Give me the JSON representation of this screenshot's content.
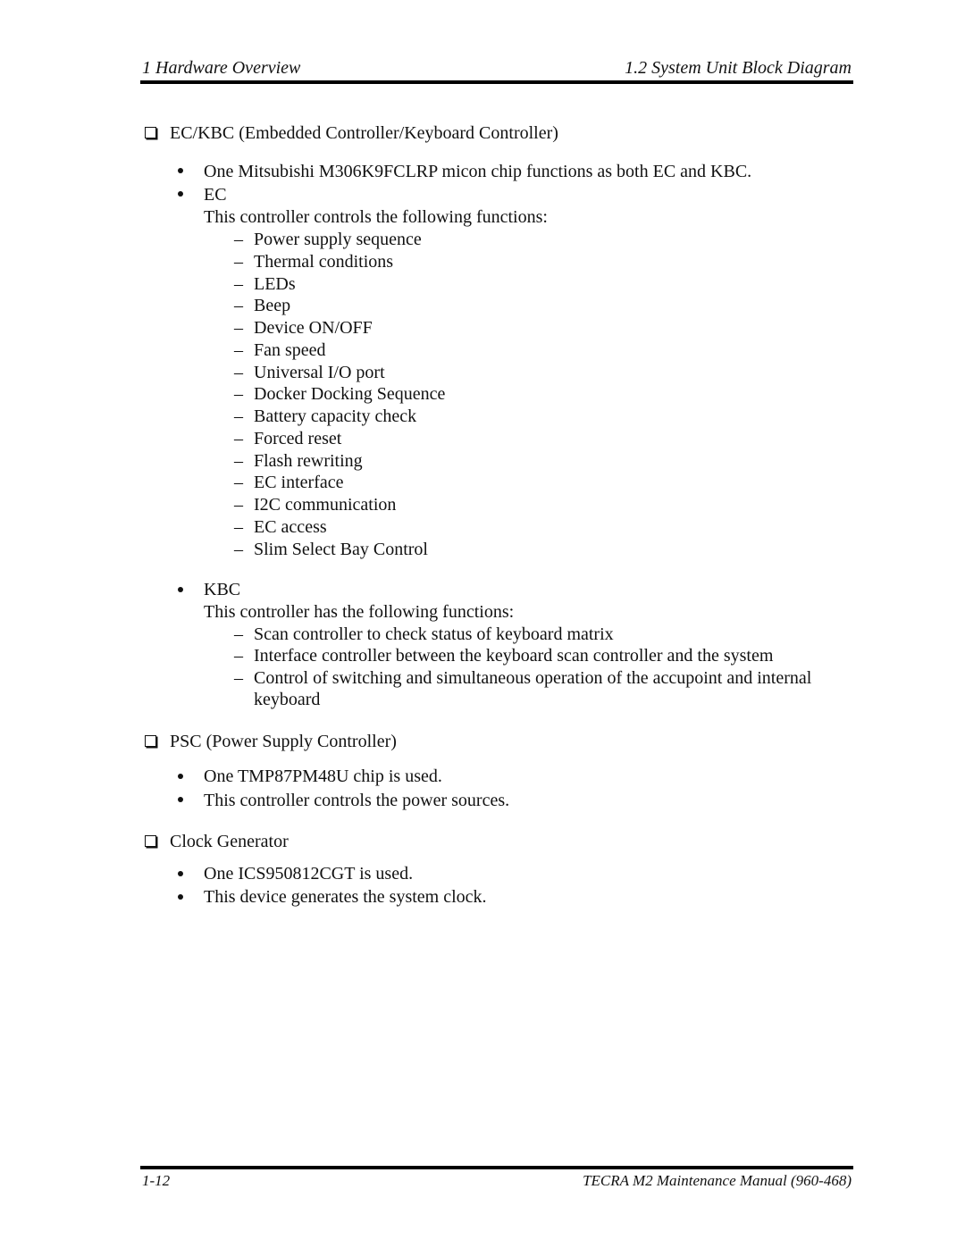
{
  "header": {
    "chapter": "1  Hardware Overview",
    "section": "1.2 System Unit Block Diagram"
  },
  "sections": {
    "eckbc": {
      "title": "EC/KBC (Embedded Controller/Keyboard Controller)",
      "bullet_chip": "One Mitsubishi M306K9FCLRP micon chip functions as both EC and KBC.",
      "ec": {
        "label": "EC",
        "intro": "This controller controls the following functions:",
        "items": [
          "Power supply sequence",
          "Thermal conditions",
          "LEDs",
          "Beep",
          "Device ON/OFF",
          "Fan speed",
          "Universal I/O port",
          "Docker Docking Sequence",
          "Battery capacity check",
          "Forced reset",
          "Flash rewriting",
          "EC interface",
          "I2C communication",
          "EC access",
          "Slim Select Bay Control"
        ]
      },
      "kbc": {
        "label": "KBC",
        "intro": "This controller has the following functions:",
        "items": [
          "Scan controller to check status of keyboard matrix",
          "Interface controller between the keyboard scan controller and the system",
          "Control of switching and simultaneous operation of the accupoint and internal",
          "keyboard"
        ]
      }
    },
    "psc": {
      "title": "PSC (Power Supply Controller)",
      "bullets": [
        "One TMP87PM48U chip is used.",
        "This controller controls the power sources."
      ]
    },
    "clock": {
      "title": "Clock Generator",
      "bullets": [
        "One ICS950812CGT is used.",
        "This device generates the system clock."
      ]
    }
  },
  "footer": {
    "page": "1-12",
    "manual": "TECRA M2 Maintenance Manual (960-468)"
  }
}
